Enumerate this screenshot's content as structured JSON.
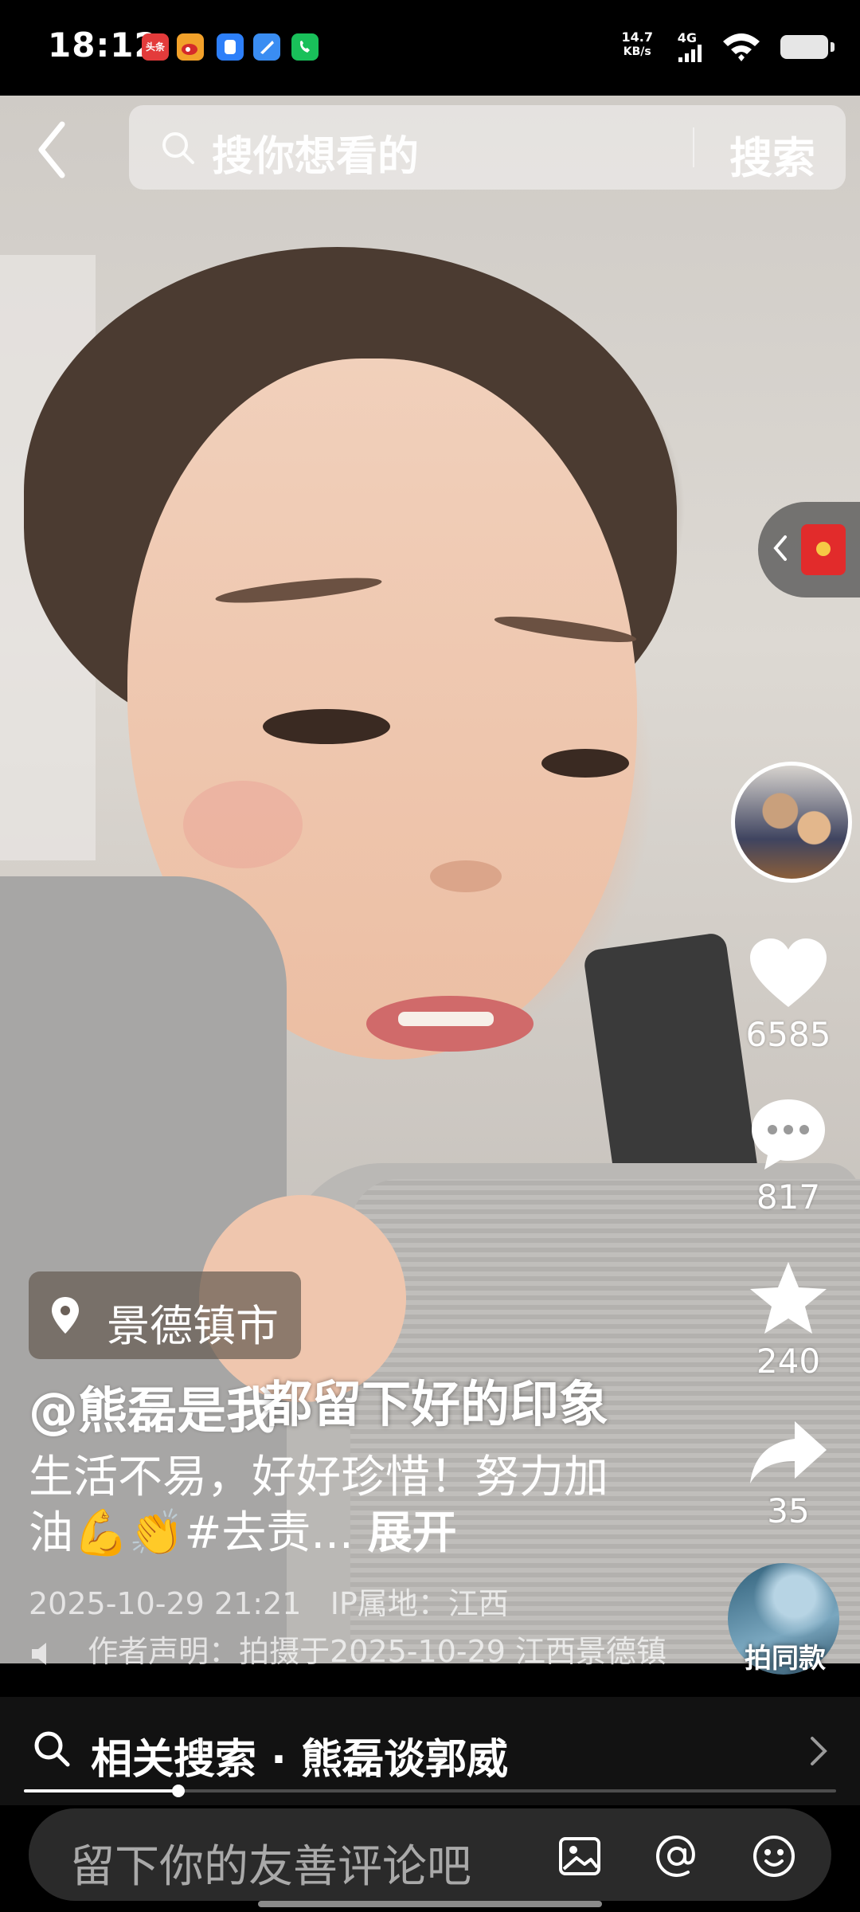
{
  "status_bar": {
    "time": "18:12",
    "net_speed_value": "14.7",
    "net_speed_unit": "KB/s",
    "network_type": "4G",
    "notification_icons": [
      "toutiao-icon",
      "weibo-icon",
      "app-blue-icon",
      "app-feather-icon",
      "app-green-call-icon"
    ],
    "notification_labels": [
      "头条",
      "",
      "",
      "",
      ""
    ],
    "notification_colors": [
      "#e33b3b",
      "#f2a12a",
      "#2d7ff9",
      "#3a8df2",
      "#19c05a"
    ]
  },
  "search": {
    "placeholder": "搜你想看的",
    "button_label": "搜索"
  },
  "side_actions": {
    "like_count": "6585",
    "comment_count": "817",
    "favorite_count": "240",
    "share_count": "35",
    "same_style_label": "拍同款"
  },
  "video_info": {
    "location": "景德镇市",
    "username": "@熊磊是我",
    "subtitle": "都留下好的印象",
    "description_text": "生活不易，好好珍惜！努力加油💪👏#去责...",
    "expand_label": "展开",
    "datetime": "2025-10-29 21:21",
    "ip_location": "IP属地：江西",
    "author_statement": "作者声明：拍摄于2025-10-29 江西景德镇"
  },
  "related_search": {
    "label": "相关搜索 · 熊磊谈郭威"
  },
  "playback": {
    "progress": 0.19
  },
  "comment_bar": {
    "placeholder": "留下你的友善评论吧"
  },
  "colors": {
    "accent_red": "#e22b2b",
    "bottom_bg": "#121212",
    "comment_bg": "#2a2a2a"
  }
}
